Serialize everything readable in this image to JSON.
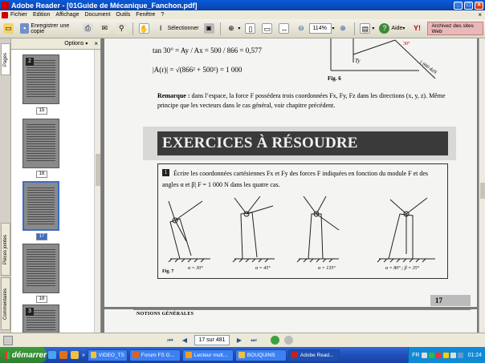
{
  "window": {
    "title": "Adobe Reader - [01Guide de Mécanique_Fanchon.pdf]",
    "controls": {
      "minimize": "_",
      "maximize": "□",
      "close": "×"
    }
  },
  "menu": {
    "items": [
      "Fichier",
      "Edition",
      "Affichage",
      "Document",
      "Outils",
      "Fenêtre",
      "?"
    ],
    "close": "×"
  },
  "toolbar": {
    "save_copy": "Enregistrer une copie",
    "select": "Sélectionner",
    "zoom": "114%",
    "help": "Aide",
    "web_archive": "Archivez des sites Web",
    "icons": [
      "open-icon",
      "save-icon",
      "print-icon",
      "email-icon",
      "search-icon",
      "hand-icon",
      "select-icon",
      "snapshot-icon",
      "zoom-in-icon",
      "actual-size-icon",
      "fit-page-icon",
      "fit-width-icon",
      "zoom-out-icon",
      "zoom-plus-icon",
      "pages-icon",
      "help-icon",
      "yahoo-icon"
    ]
  },
  "side_tabs": [
    "Pages",
    "Pièces jointes",
    "Commentaires"
  ],
  "panel": {
    "options": "Options",
    "close": "×",
    "pages": [
      {
        "label": "15",
        "current": false
      },
      {
        "label": "16",
        "current": false
      },
      {
        "label": "17",
        "current": true
      },
      {
        "label": "18",
        "current": false
      }
    ]
  },
  "document": {
    "formula1": "tan 30° = Ay / Ax = 500 / 866 = 0,577",
    "formula2": "|A(r)| = √(866² + 500²) = 1 000",
    "fig6": "Fig. 6",
    "remark_title": "Remarque :",
    "remark_body": " dans l’espace, la force F possédera trois coordonnées Fx, Fy, Fz dans les directions (x, y, z). Même principe que les vecteurs dans le cas général, voir chapitre précédent.",
    "banner": "EXERCICES À RÉSOUDRE",
    "exercise_number": "1",
    "exercise_text": "Écrire les coordonnées cartésiennes Fx et Fy des forces F indiquées en fonction du module F et des angles α et β| F = 1 000 N dans les quatre cas.",
    "captions": [
      "α = 30°",
      "α = 45°",
      "α = 135°",
      "α = 80° ; β = 35°"
    ],
    "fig7": "Fig. 7",
    "page_number": "17",
    "next_section": "NOTIONS GÉNÉRALES"
  },
  "nav": {
    "page_indicator": "17 sur 481"
  },
  "taskbar": {
    "start": "démarrer",
    "tasks": [
      {
        "label": "VIDEO_TS",
        "color": "#f0c040"
      },
      {
        "label": "Forum FS G...",
        "color": "#e06020"
      },
      {
        "label": "Lecteur mult...",
        "color": "#f0a020"
      },
      {
        "label": "BOUQUINS",
        "color": "#f0c040"
      },
      {
        "label": "Adobe Read...",
        "color": "#c82020",
        "active": true
      }
    ],
    "lang": "FR",
    "clock": "01:24"
  }
}
